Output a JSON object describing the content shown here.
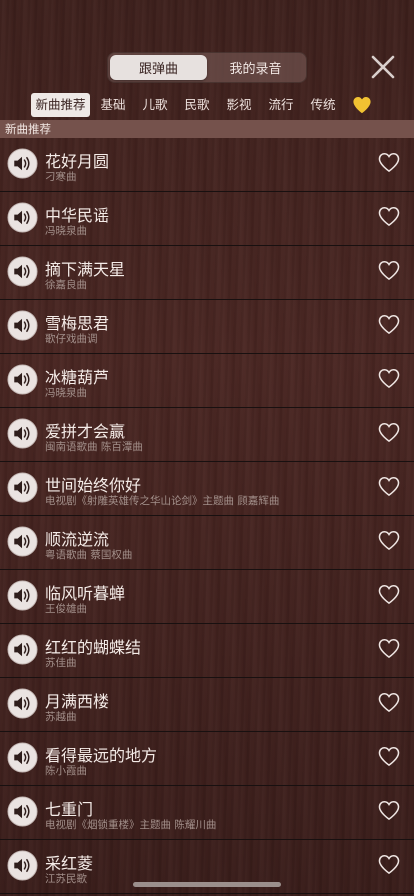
{
  "header": {
    "segment": [
      "跟弹曲",
      "我的录音"
    ],
    "close_icon": "close-icon"
  },
  "tabs": [
    "新曲推荐",
    "基础",
    "儿歌",
    "民歌",
    "影视",
    "流行",
    "传统"
  ],
  "favorites_tab_icon": "yellow-heart-icon",
  "section_title": "新曲推荐",
  "colors": {
    "background": "#3e201c",
    "section": "#75524c",
    "heart": "#f1c232"
  },
  "songs": [
    {
      "title": "花好月圆",
      "subtitle": "刁寒曲"
    },
    {
      "title": "中华民谣",
      "subtitle": "冯晓泉曲"
    },
    {
      "title": "摘下满天星",
      "subtitle": "徐嘉良曲"
    },
    {
      "title": "雪梅思君",
      "subtitle": "歌仔戏曲调"
    },
    {
      "title": "冰糖葫芦",
      "subtitle": "冯晓泉曲"
    },
    {
      "title": "爱拼才会赢",
      "subtitle": "闽南语歌曲 陈百潭曲"
    },
    {
      "title": "世间始终你好",
      "subtitle": "电视剧《射雕英雄传之华山论剑》主题曲 顾嘉辉曲"
    },
    {
      "title": "顺流逆流",
      "subtitle": "粤语歌曲 蔡国权曲"
    },
    {
      "title": "临风听暮蝉",
      "subtitle": "王俊雄曲"
    },
    {
      "title": "红红的蝴蝶结",
      "subtitle": "苏佳曲"
    },
    {
      "title": "月满西楼",
      "subtitle": "苏越曲"
    },
    {
      "title": "看得最远的地方",
      "subtitle": "陈小霞曲"
    },
    {
      "title": "七重门",
      "subtitle": "电视剧《烟锁重楼》主题曲 陈耀川曲"
    },
    {
      "title": "采红菱",
      "subtitle": "江苏民歌"
    }
  ]
}
